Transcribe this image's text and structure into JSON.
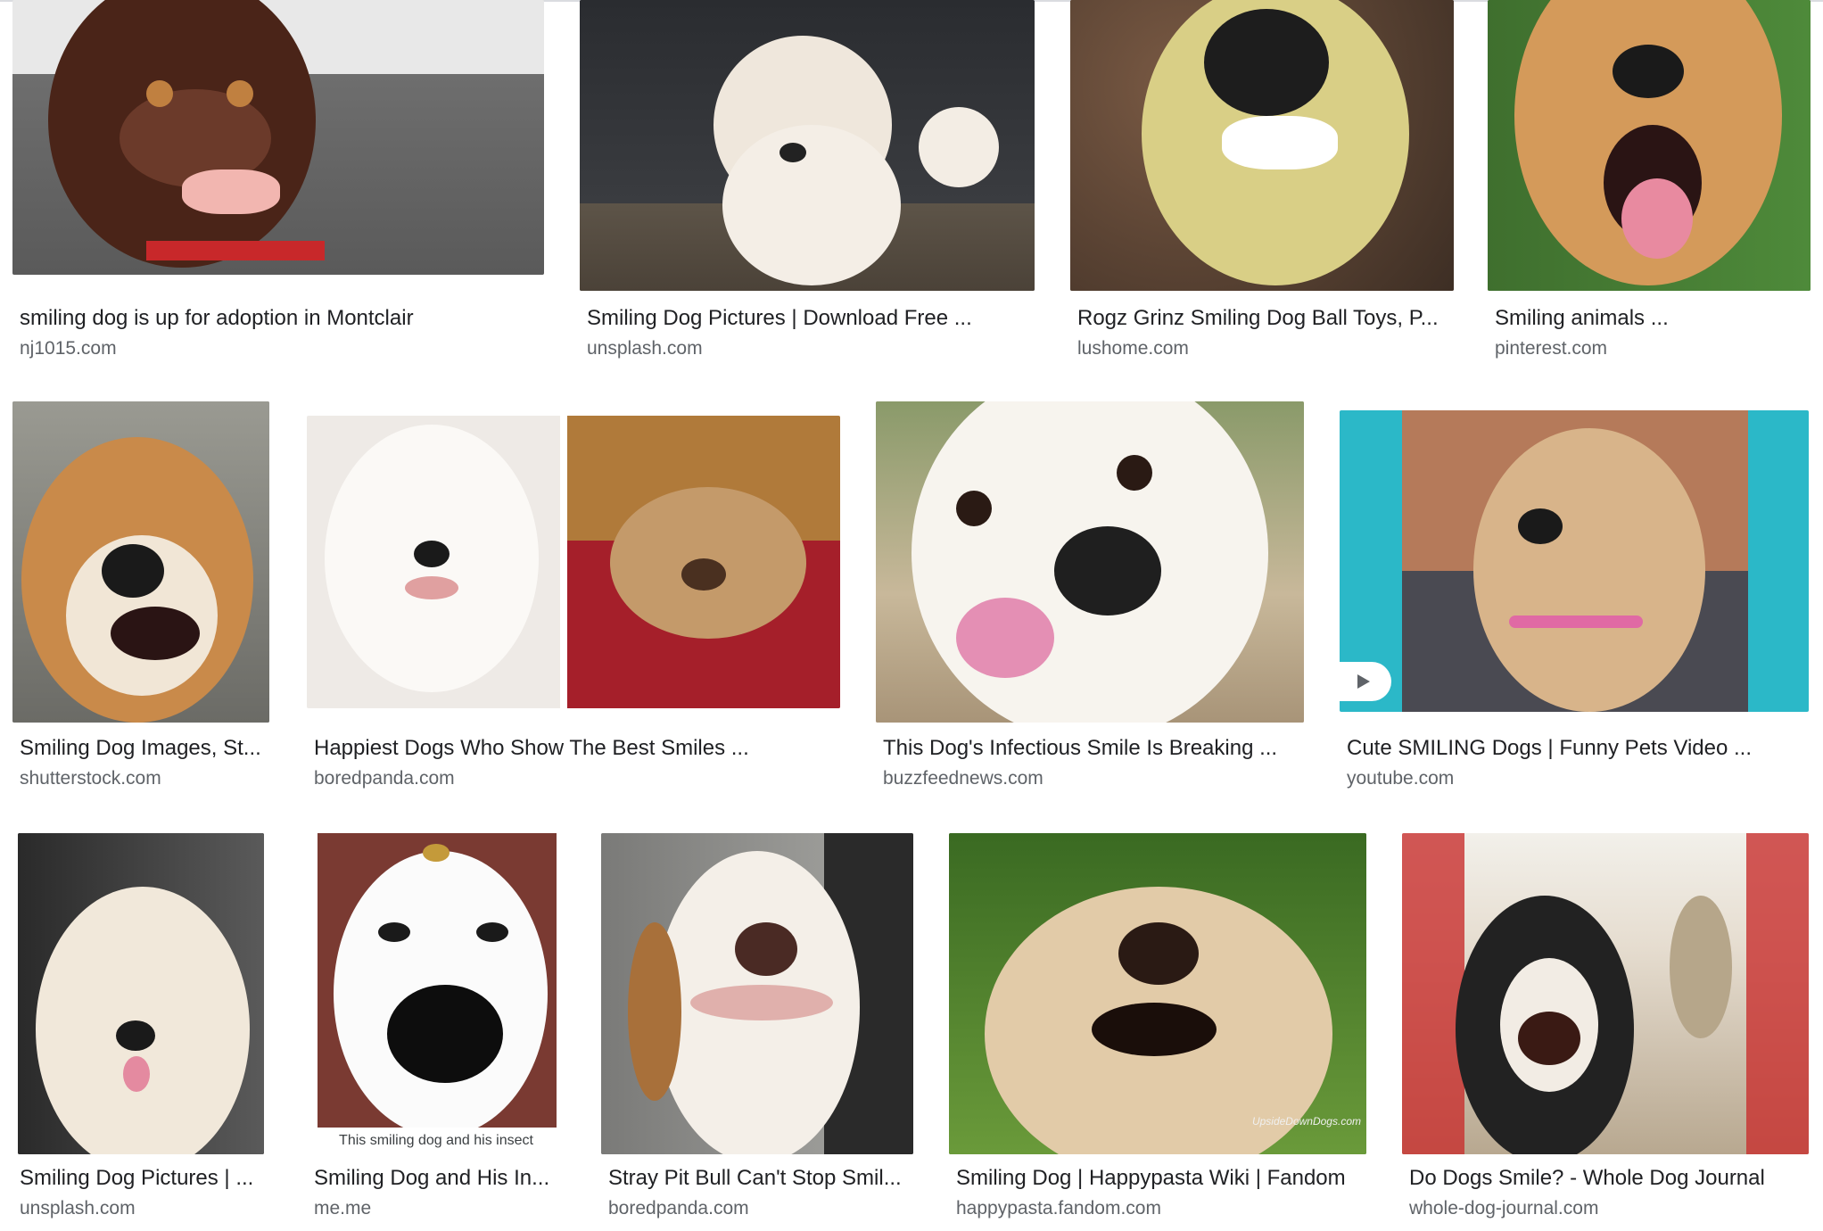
{
  "results": [
    {
      "title": "smiling dog is up for adoption in Montclair",
      "source": "nj1015.com",
      "icon": "brown-dog-image"
    },
    {
      "title": "Smiling Dog Pictures | Download Free ...",
      "source": "unsplash.com",
      "icon": "white-fluffy-dog-image"
    },
    {
      "title": "Rogz Grinz Smiling Dog Ball Toys, P...",
      "source": "lushome.com",
      "icon": "dog-with-teeth-toy-image"
    },
    {
      "title": "Smiling animals ...",
      "source": "pinterest.com",
      "icon": "shiba-dog-image"
    },
    {
      "title": "Smiling Dog Images, St...",
      "source": "shutterstock.com",
      "icon": "shepherd-dog-image"
    },
    {
      "title": "Happiest Dogs Who Show The Best Smiles ...",
      "source": "boredpanda.com",
      "icon": "samoyed-and-shar-pei-image"
    },
    {
      "title": "This Dog's Infectious Smile Is Breaking ...",
      "source": "buzzfeednews.com",
      "icon": "white-dog-flower-image"
    },
    {
      "title": "Cute SMILING Dogs | Funny Pets Video ...",
      "source": "youtube.com",
      "icon": "video-dog-image"
    },
    {
      "title": "Smiling Dog Pictures | ...",
      "source": "unsplash.com",
      "icon": "golden-retriever-image"
    },
    {
      "title": "Smiling Dog and His In...",
      "source": "me.me",
      "icon": "dog-with-insect-image",
      "caption": "This smiling dog and his insect"
    },
    {
      "title": "Stray Pit Bull Can't Stop Smil...",
      "source": "boredpanda.com",
      "icon": "pit-bull-image"
    },
    {
      "title": "Smiling Dog | Happypasta Wiki | Fandom",
      "source": "happypasta.fandom.com",
      "icon": "upside-down-dog-image",
      "watermark": "UpsideDownDogs.com"
    },
    {
      "title": "Do Dogs Smile? - Whole Dog Journal",
      "source": "whole-dog-journal.com",
      "icon": "dog-on-bridge-image"
    }
  ]
}
